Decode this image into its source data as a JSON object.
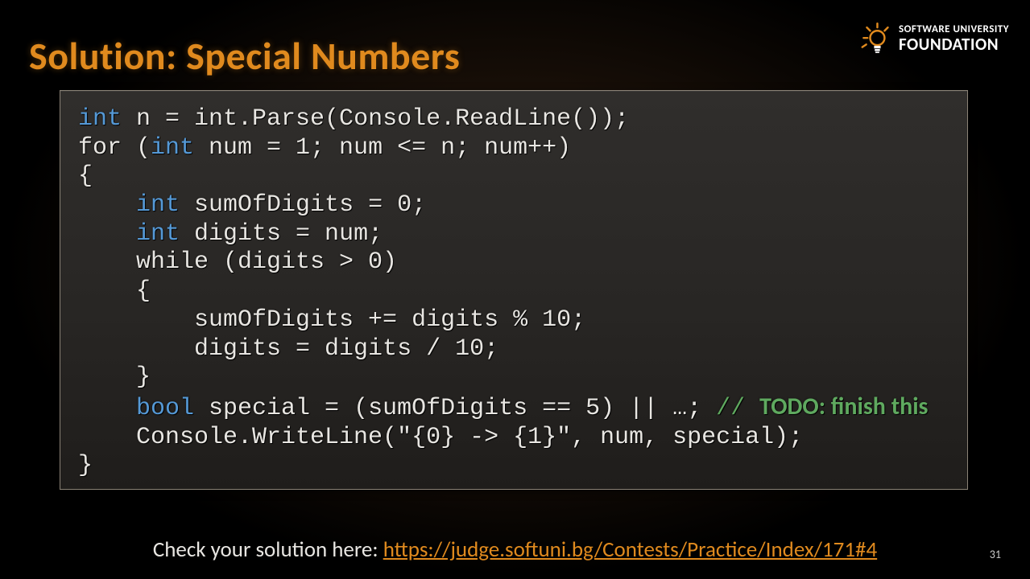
{
  "title": "Solution: Special Numbers",
  "logo": {
    "line1": "SOFTWARE UNIVERSITY",
    "line2": "FOUNDATION"
  },
  "code": {
    "l1_kw": "int",
    "l1_rest": " n = int.Parse(Console.ReadLine());",
    "l2_a": "for (",
    "l2_kw": "int",
    "l2_b": " num = 1; num <= n; num++)",
    "l3": "{",
    "l4_pad": "    ",
    "l4_kw": "int",
    "l4_rest": " sumOfDigits = 0;",
    "l5_pad": "    ",
    "l5_kw": "int",
    "l5_rest": " digits = num;",
    "l6": "    while (digits > 0)",
    "l7": "    {",
    "l8": "        sumOfDigits += digits % 10;",
    "l9": "        digits = digits / 10;",
    "l10": "    }",
    "l11_pad": "    ",
    "l11_kw": "bool",
    "l11_rest": " special = (sumOfDigits == 5) || …; ",
    "l11_cm_lead": "// ",
    "l11_cm": "TODO: finish this",
    "l12": "    Console.WriteLine(\"{0} -> {1}\", num, special);",
    "l13": "}"
  },
  "footer": {
    "label": "Check your solution here: ",
    "link": "https://judge.softuni.bg/Contests/Practice/Index/171#4"
  },
  "page": "31"
}
